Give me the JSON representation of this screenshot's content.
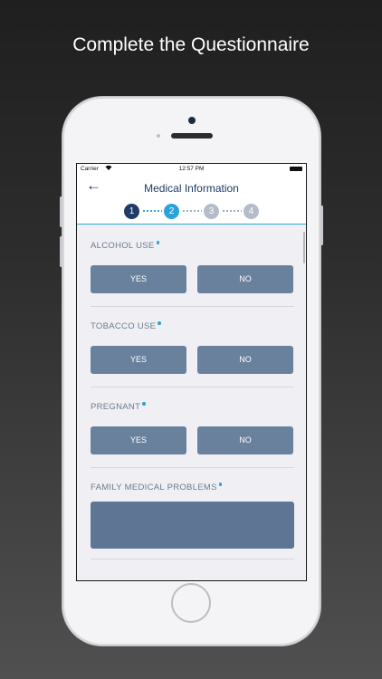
{
  "headline": "Complete the Questionnaire",
  "status_bar": {
    "carrier": "Carrier",
    "time": "12:57 PM"
  },
  "nav": {
    "back_glyph": "←",
    "title": "Medical Information"
  },
  "stepper": {
    "steps": [
      "1",
      "2",
      "3",
      "4"
    ],
    "current": 2
  },
  "questions": [
    {
      "label": "ALCOHOL USE",
      "yes": "YES",
      "no": "NO"
    },
    {
      "label": "TOBACCO USE",
      "yes": "YES",
      "no": "NO"
    },
    {
      "label": "PREGNANT",
      "yes": "YES",
      "no": "NO"
    }
  ],
  "family": {
    "label": "FAMILY MEDICAL PROBLEMS"
  },
  "colors": {
    "nav_text": "#1f3b66",
    "accent": "#2aa3d9",
    "button": "#6a819d",
    "step_done": "#1f3b66",
    "step_pending": "#b3bcc8"
  }
}
